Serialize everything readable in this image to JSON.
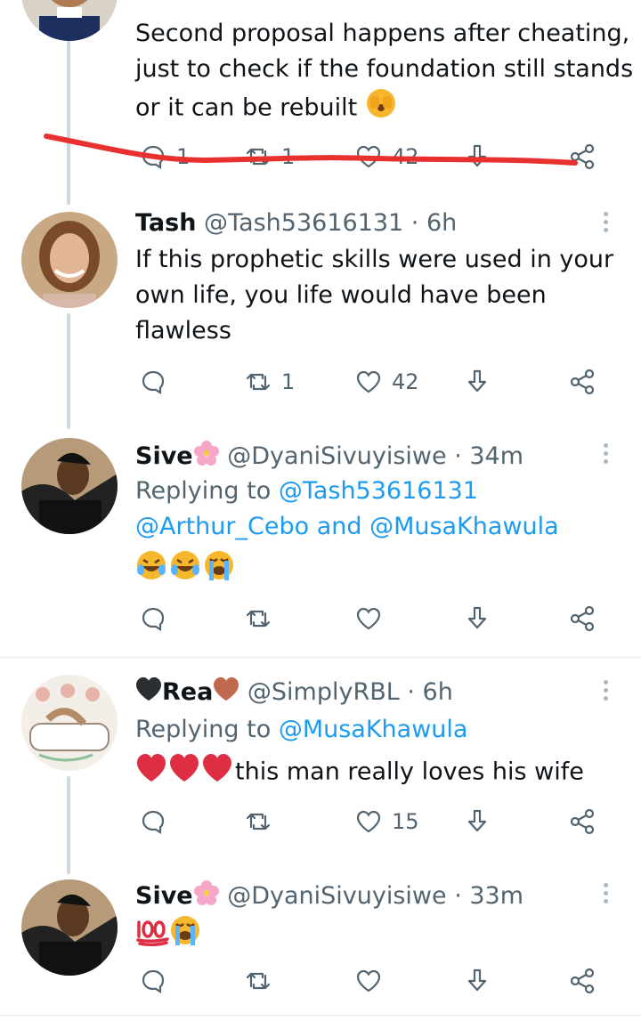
{
  "tweets": [
    {
      "text": "Second proposal happens after cheating, just to check if the foundation still stands or it can be rebuilt",
      "emoji": "🫣",
      "replies": "1",
      "retweets": "1",
      "likes": "42"
    },
    {
      "name": "Tash",
      "handle": "@Tash53616131 · 6h",
      "text": "If this prophetic skills were used in your own life, you life would have been flawless",
      "replies": "",
      "retweets": "1",
      "likes": "42"
    },
    {
      "name": "Sive",
      "handle": "@DyaniSivuyisiwe · 34m",
      "replying_prefix": "Replying to ",
      "replying_line1": "@Tash53616131",
      "replying_line2a": "@Arthur_Cebo",
      "replying_and": " and ",
      "replying_line2b": "@MusaKhawula",
      "emojis": "😂😂😭",
      "replies": "",
      "retweets": "",
      "likes": ""
    },
    {
      "name": "Rea",
      "handle": "@SimplyRBL · 6h",
      "replying_prefix": "Replying to ",
      "replying_to": "@MusaKhawula",
      "text": "this man really loves his wife",
      "replies": "",
      "retweets": "",
      "likes": "15"
    },
    {
      "name": "Sive",
      "handle": "@DyaniSivuyisiwe · 33m",
      "emojis": "💯😭",
      "replies": "",
      "retweets": "",
      "likes": ""
    }
  ],
  "colors": {
    "link": "#1d9bf0",
    "muted": "#536471",
    "annotation": "#e8312f"
  }
}
